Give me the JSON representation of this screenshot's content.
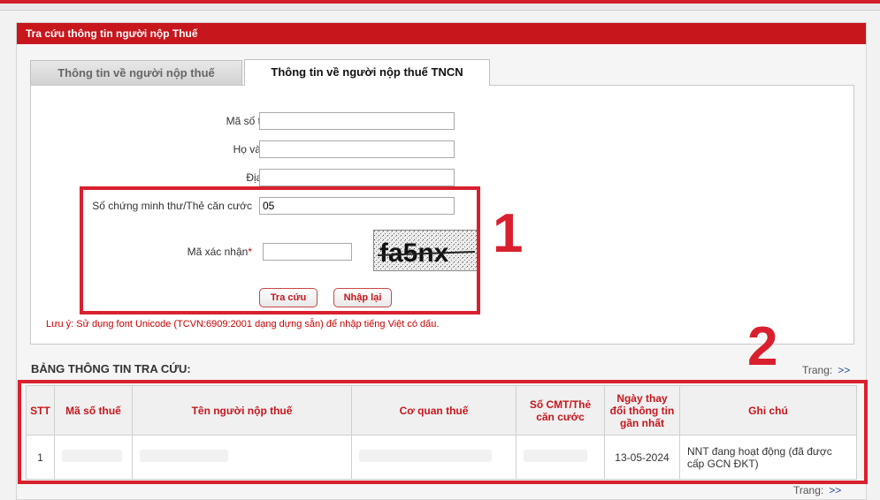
{
  "panel": {
    "title": "Tra cứu thông tin người nộp Thuế"
  },
  "tabs": [
    {
      "label": "Thông tin về người nộp thuế"
    },
    {
      "label": "Thông tin về người nộp thuế TNCN"
    }
  ],
  "form": {
    "tax_code_label": "Mã số thuế",
    "tax_code_value": "",
    "name_label": "Họ và tên",
    "name_value": "",
    "address_label": "Địa chỉ",
    "address_value": "",
    "id_label": "Số chứng minh thư/Thẻ căn cước",
    "id_value": "05",
    "captcha_label": "Mã xác nhận",
    "captcha_required": "*",
    "captcha_value": "",
    "captcha_text": "fa5nx",
    "search_button": "Tra cứu",
    "reset_button": "Nhập lại",
    "note": "Lưu ý: Sử dụng font Unicode (TCVN:6909:2001 dạng dựng sẵn) để nhập tiếng Việt có dấu."
  },
  "annotations": {
    "one": "1",
    "two": "2"
  },
  "results": {
    "title": "BẢNG THÔNG TIN TRA CỨU:",
    "pager_label": "Trang:",
    "pager_next": ">>",
    "columns": [
      "STT",
      "Mã số thuế",
      "Tên người nộp thuế",
      "Cơ quan thuế",
      "Số CMT/Thẻ căn cước",
      "Ngày thay đổi thông tin gần nhất",
      "Ghi chú"
    ],
    "rows": [
      {
        "stt": "1",
        "date": "13-05-2024",
        "note": "NNT đang hoạt động (đã được cấp GCN ĐKT)"
      }
    ]
  },
  "colors": {
    "brand_red": "#c8161d",
    "annotation_red": "#d9202e"
  }
}
